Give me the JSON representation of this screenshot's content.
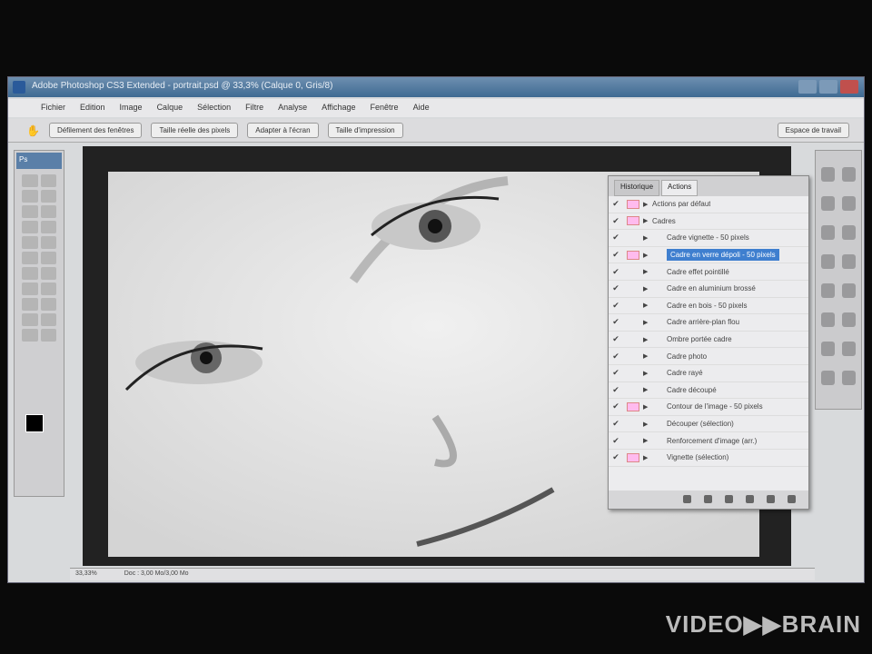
{
  "window": {
    "title": "Adobe Photoshop CS3 Extended - portrait.psd @ 33,3% (Calque 0, Gris/8)"
  },
  "menu": [
    "Fichier",
    "Edition",
    "Image",
    "Calque",
    "Sélection",
    "Filtre",
    "Analyse",
    "Affichage",
    "Fenêtre",
    "Aide"
  ],
  "options": {
    "buttons": [
      "Défilement des fenêtres",
      "Taille réelle des pixels",
      "Adapter à l'écran",
      "Taille d'impression"
    ],
    "workspace": "Espace de travail"
  },
  "tools": {
    "badge": "Ps"
  },
  "actions_panel": {
    "tabs": [
      "Historique",
      "Actions"
    ],
    "items": [
      {
        "label": "Actions par défaut",
        "level": 0,
        "dialog": true,
        "selected": false
      },
      {
        "label": "Cadres",
        "level": 0,
        "dialog": true,
        "selected": false
      },
      {
        "label": "Cadre vignette - 50 pixels",
        "level": 1,
        "dialog": false,
        "selected": false
      },
      {
        "label": "Cadre en verre dépoli - 50 pixels",
        "level": 1,
        "dialog": true,
        "selected": true
      },
      {
        "label": "Cadre effet pointillé",
        "level": 1,
        "dialog": false,
        "selected": false
      },
      {
        "label": "Cadre en aluminium brossé",
        "level": 1,
        "dialog": false,
        "selected": false
      },
      {
        "label": "Cadre en bois - 50 pixels",
        "level": 1,
        "dialog": false,
        "selected": false
      },
      {
        "label": "Cadre arrière-plan flou",
        "level": 1,
        "dialog": false,
        "selected": false
      },
      {
        "label": "Ombre portée cadre",
        "level": 1,
        "dialog": false,
        "selected": false
      },
      {
        "label": "Cadre photo",
        "level": 1,
        "dialog": false,
        "selected": false
      },
      {
        "label": "Cadre rayé",
        "level": 1,
        "dialog": false,
        "selected": false
      },
      {
        "label": "Cadre découpé",
        "level": 1,
        "dialog": false,
        "selected": false
      },
      {
        "label": "Contour de l'image - 50 pixels",
        "level": 1,
        "dialog": true,
        "selected": false
      },
      {
        "label": "Découper (sélection)",
        "level": 1,
        "dialog": false,
        "selected": false
      },
      {
        "label": "Renforcement d'image (arr.)",
        "level": 1,
        "dialog": false,
        "selected": false
      },
      {
        "label": "Vignette (sélection)",
        "level": 1,
        "dialog": true,
        "selected": false
      }
    ]
  },
  "status": {
    "zoom": "33,33%",
    "doc": "Doc : 3,00 Mo/3,00 Mo"
  },
  "watermark": "VIDEO▶▶BRAIN"
}
